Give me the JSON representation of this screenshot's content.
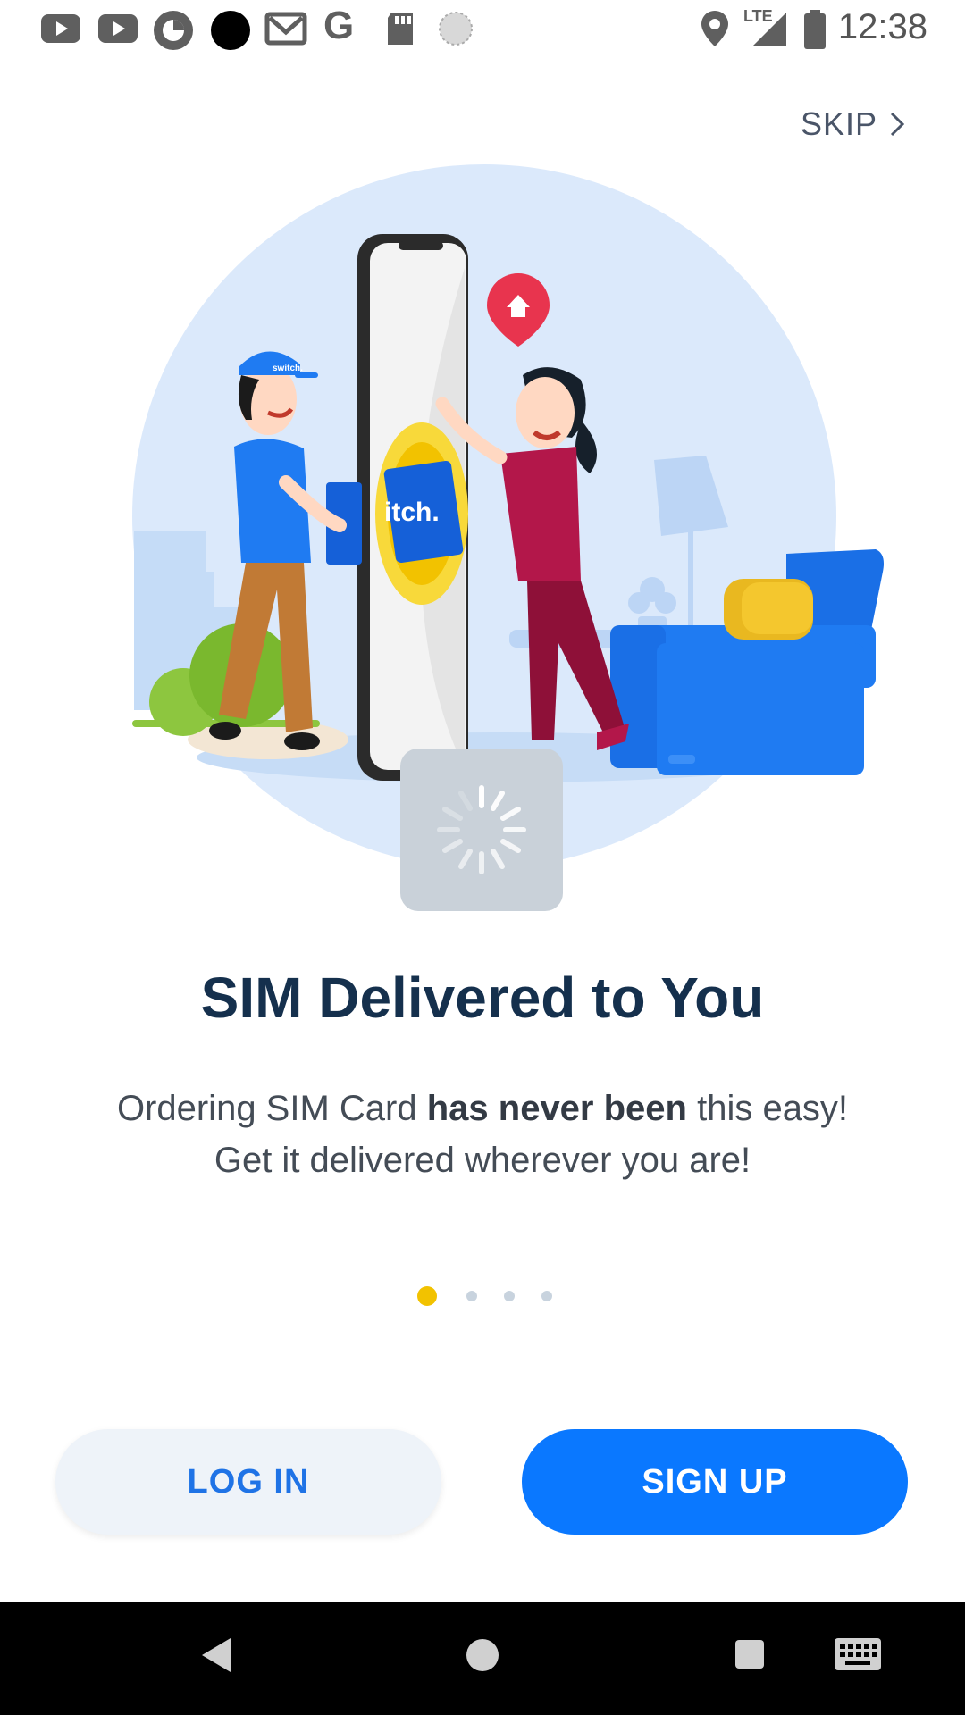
{
  "status_bar": {
    "time": "12:38",
    "network": "LTE",
    "left_icons": [
      "youtube-icon",
      "youtube-icon",
      "app-icon",
      "black-circle-icon",
      "gmail-icon",
      "google-icon",
      "sd-card-icon",
      "loading-icon"
    ],
    "right_icons": [
      "location-icon",
      "signal-icon",
      "battery-icon"
    ]
  },
  "skip": {
    "label": "SKIP"
  },
  "illustration": {
    "brand_text": "switch.",
    "phone_text": "itch."
  },
  "onboarding": {
    "title": "SIM Delivered to You",
    "line1_a": "Ordering SIM Card ",
    "line1_b": "has never been",
    "line1_c": " this easy!",
    "line2": "Get it delivered wherever you are!"
  },
  "pager": {
    "pages": 4,
    "active": 1,
    "active_color": "#f2c200",
    "inactive_color": "#c8d3de"
  },
  "buttons": {
    "login": "LOG IN",
    "signup": "SIGN UP"
  },
  "colors": {
    "primary": "#0a78ff",
    "title": "#15304d",
    "login_bg": "#eef3f9"
  }
}
